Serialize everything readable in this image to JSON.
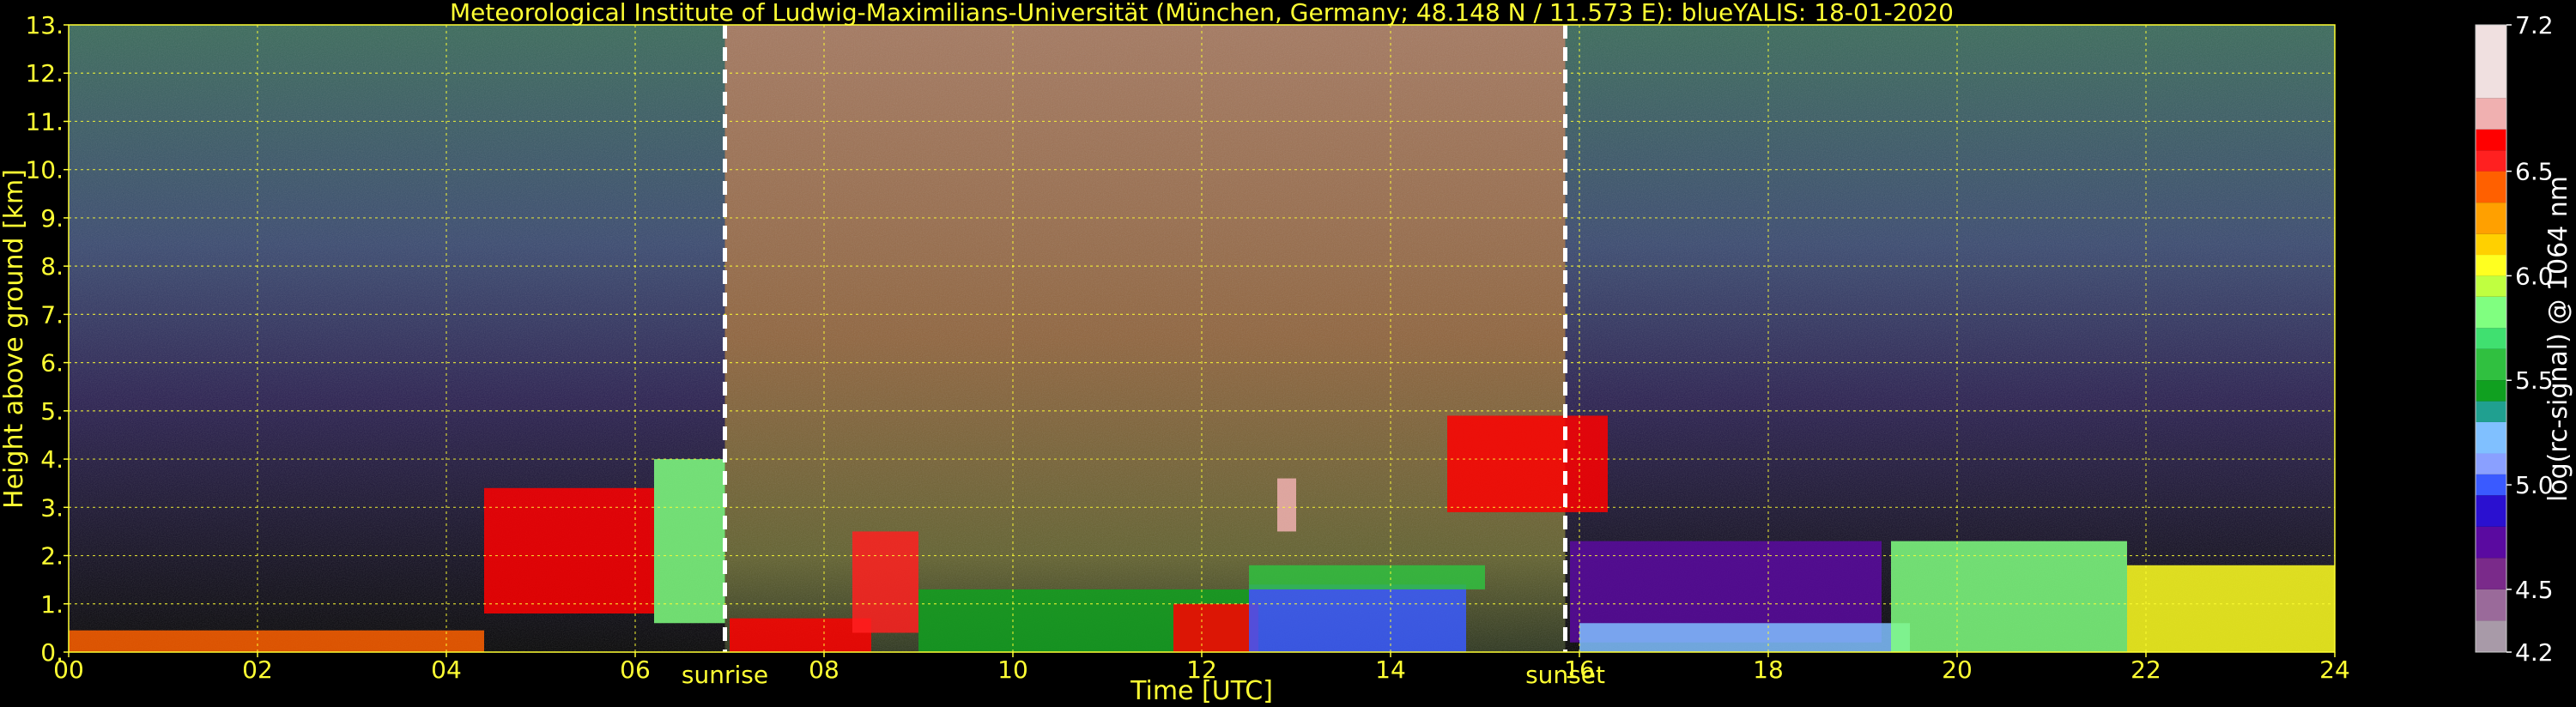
{
  "chart_data": {
    "type": "heatmap",
    "title": "Meteorological Institute of Ludwig-Maximilians-Universität (München, Germany; 48.148 N / 11.573 E):     blueYALIS: 18-01-2020",
    "xlabel": "Time [UTC]",
    "ylabel": "Height above ground [km]",
    "xlim": [
      0,
      24
    ],
    "ylim": [
      0,
      13
    ],
    "x_ticks": [
      "00",
      "02",
      "04",
      "06",
      "08",
      "10",
      "12",
      "14",
      "16",
      "18",
      "20",
      "22",
      "24"
    ],
    "y_ticks": [
      "0.",
      "1.",
      "2.",
      "3.",
      "4.",
      "5.",
      "6.",
      "7.",
      "8.",
      "9.",
      "10.",
      "11.",
      "12.",
      "13."
    ],
    "grid": true,
    "events": [
      {
        "label": "sunrise",
        "time": 6.95
      },
      {
        "label": "sunset",
        "time": 15.85
      }
    ],
    "colorbar": {
      "label": "log(rc-signal) @ 1064 nm",
      "range": [
        4.2,
        7.2
      ],
      "ticks": [
        "4.2",
        "4.5",
        "5.0",
        "5.5",
        "6.0",
        "6.5",
        "7.2"
      ]
    },
    "layers": [
      {
        "t0": 0.0,
        "t1": 4.4,
        "h0": 0.0,
        "h1": 0.45,
        "level": 6.4
      },
      {
        "t0": 4.4,
        "t1": 6.2,
        "h0": 0.8,
        "h1": 3.4,
        "level": 6.6
      },
      {
        "t0": 6.2,
        "t1": 6.95,
        "h0": 0.6,
        "h1": 4.0,
        "level": 5.8
      },
      {
        "t0": 7.0,
        "t1": 8.5,
        "h0": 0.0,
        "h1": 0.7,
        "level": 6.6
      },
      {
        "t0": 8.3,
        "t1": 9.0,
        "h0": 0.4,
        "h1": 2.5,
        "level": 6.5
      },
      {
        "t0": 9.0,
        "t1": 12.5,
        "h0": 0.0,
        "h1": 1.3,
        "level": 5.4
      },
      {
        "t0": 11.7,
        "t1": 12.6,
        "h0": 0.0,
        "h1": 1.0,
        "level": 6.6
      },
      {
        "t0": 12.5,
        "t1": 14.8,
        "h0": 0.0,
        "h1": 1.4,
        "level": 5.0
      },
      {
        "t0": 12.5,
        "t1": 15.0,
        "h0": 1.3,
        "h1": 1.8,
        "level": 5.6
      },
      {
        "t0": 12.8,
        "t1": 13.0,
        "h0": 2.5,
        "h1": 3.6,
        "level": 6.8
      },
      {
        "t0": 14.6,
        "t1": 16.3,
        "h0": 2.9,
        "h1": 4.9,
        "level": 6.6
      },
      {
        "t0": 15.9,
        "t1": 19.2,
        "h0": 0.2,
        "h1": 2.3,
        "level": 4.7
      },
      {
        "t0": 16.0,
        "t1": 19.5,
        "h0": 0.0,
        "h1": 0.6,
        "level": 5.2
      },
      {
        "t0": 19.3,
        "t1": 21.8,
        "h0": 0.0,
        "h1": 2.3,
        "level": 5.8
      },
      {
        "t0": 21.8,
        "t1": 24.0,
        "h0": 0.0,
        "h1": 1.8,
        "level": 6.0
      }
    ]
  }
}
